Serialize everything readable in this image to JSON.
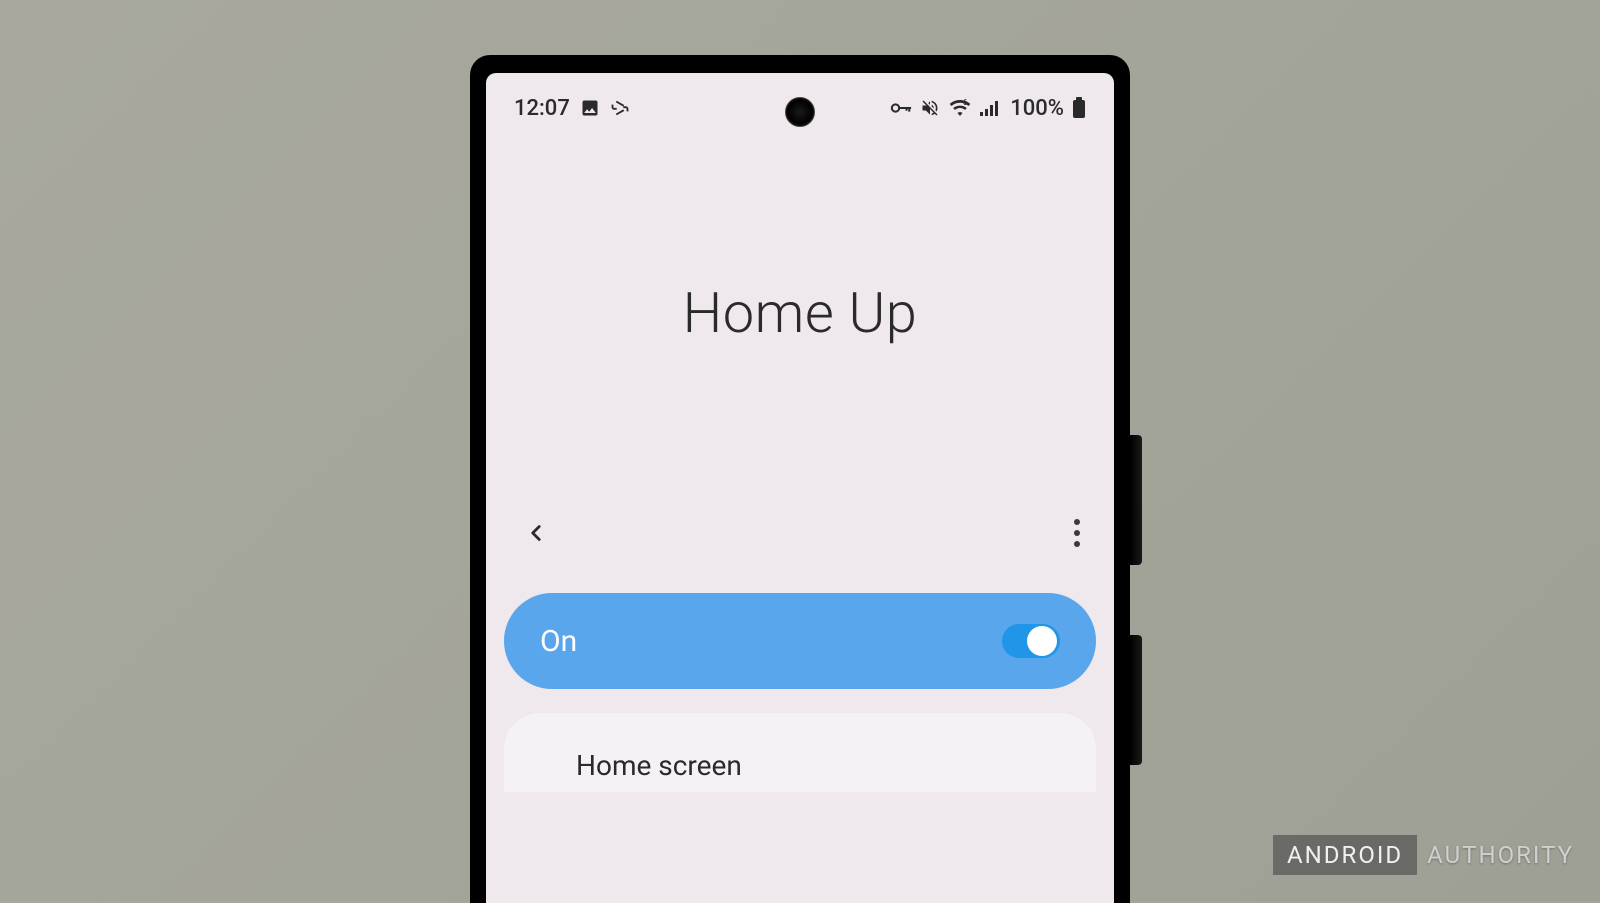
{
  "status_bar": {
    "time": "12:07",
    "left_icons": [
      "image-icon",
      "rotation-icon"
    ],
    "right_icons": [
      "vpn-key-icon",
      "mute-icon",
      "wifi-icon",
      "signal-icon"
    ],
    "battery_pct": "100%"
  },
  "page": {
    "title": "Home Up"
  },
  "nav": {
    "back_icon": "back-icon",
    "more_icon": "more-icon"
  },
  "main_toggle": {
    "label": "On",
    "state": true
  },
  "list_items": [
    {
      "title": "Home screen"
    }
  ],
  "watermark": {
    "badge": "ANDROID",
    "text": "AUTHORITY"
  }
}
